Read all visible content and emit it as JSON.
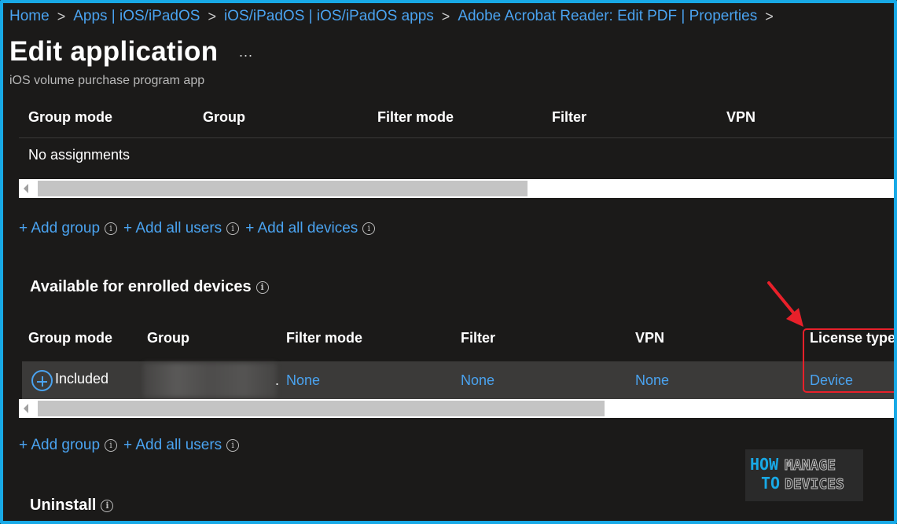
{
  "breadcrumb": [
    "Home",
    "Apps | iOS/iPadOS",
    "iOS/iPadOS | iOS/iPadOS apps",
    "Adobe Acrobat Reader: Edit PDF | Properties"
  ],
  "header": {
    "title": "Edit application",
    "more": "...",
    "subtitle": "iOS volume purchase program app"
  },
  "required_table": {
    "headers": [
      "Group mode",
      "Group",
      "Filter mode",
      "Filter",
      "VPN"
    ],
    "empty_text": "No assignments",
    "scroll_fraction": 0.57
  },
  "required_actions": [
    "+ Add group",
    "+ Add all users",
    "+ Add all devices"
  ],
  "available_section": {
    "title": "Available for enrolled devices",
    "headers": [
      "Group mode",
      "Group",
      "Filter mode",
      "Filter",
      "VPN",
      "License type"
    ],
    "rows": [
      {
        "group_mode": "Included",
        "group": ".",
        "filter_mode": "None",
        "filter": "None",
        "vpn": "None",
        "license_type": "Device"
      }
    ],
    "scroll_fraction": 0.66
  },
  "available_actions": [
    "+ Add group",
    "+ Add all users"
  ],
  "uninstall_section": {
    "title": "Uninstall"
  },
  "watermark": {
    "line1": "HOW",
    "line2": "TO",
    "word1": "MANAGE",
    "word2": "DEVICES"
  },
  "colors": {
    "accent": "#4aa3f0",
    "frame": "#18a9e6",
    "callout": "#e8202a",
    "background": "#1b1a19"
  }
}
